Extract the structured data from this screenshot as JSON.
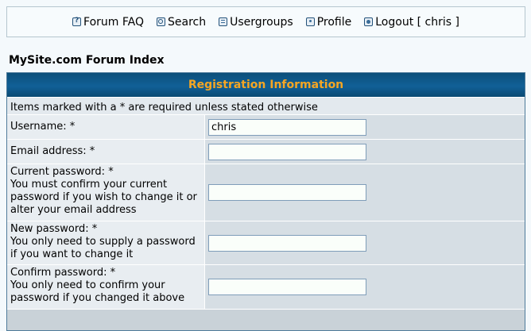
{
  "nav": {
    "items": [
      {
        "label": "Forum FAQ",
        "icon": "faq-icon"
      },
      {
        "label": "Search",
        "icon": "search-icon"
      },
      {
        "label": "Usergroups",
        "icon": "usergroups-icon"
      },
      {
        "label": "Profile",
        "icon": "profile-icon"
      },
      {
        "label": "Logout [ chris ]",
        "icon": "logout-icon"
      }
    ]
  },
  "site_title": "MySite.com Forum Index",
  "form": {
    "header": "Registration Information",
    "note": "Items marked with a * are required unless stated otherwise",
    "fields": [
      {
        "label": "Username: *",
        "hint": "",
        "value": "chris"
      },
      {
        "label": "Email address: *",
        "hint": "",
        "value": ""
      },
      {
        "label": "Current password: *",
        "hint": "You must confirm your current password if you wish to change it or alter your email address",
        "value": ""
      },
      {
        "label": "New password: *",
        "hint": "You only need to supply a password if you want to change it",
        "value": ""
      },
      {
        "label": "Confirm password: *",
        "hint": "You only need to confirm your password if you changed it above",
        "value": ""
      }
    ]
  },
  "colors": {
    "header_bg": "#116097",
    "header_text": "#f5a623",
    "cell_light": "#e8edf1",
    "cell_dark": "#d6dee4"
  }
}
